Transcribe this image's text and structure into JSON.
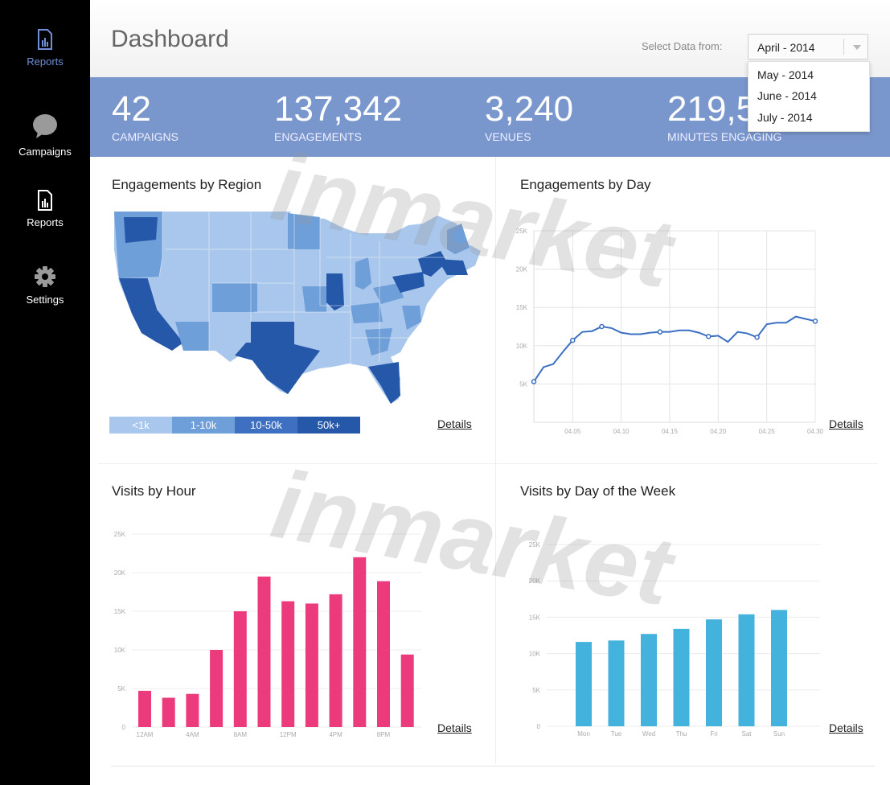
{
  "sidebar": {
    "items": [
      {
        "label": "Reports",
        "icon": "report-icon",
        "active": true
      },
      {
        "label": "Campaigns",
        "icon": "chat-bubble-icon",
        "active": false
      },
      {
        "label": "Reports",
        "icon": "report-icon",
        "active": false
      },
      {
        "label": "Settings",
        "icon": "gear-icon",
        "active": false
      }
    ]
  },
  "header": {
    "title": "Dashboard",
    "select_label": "Select Data from:",
    "selected": "April - 2014",
    "options": [
      "May - 2014",
      "June - 2014",
      "July - 2014"
    ]
  },
  "stats": [
    {
      "value": "42",
      "label": "CAMPAIGNS"
    },
    {
      "value": "137,342",
      "label": "ENGAGEMENTS"
    },
    {
      "value": "3,240",
      "label": "VENUES"
    },
    {
      "value": "219,5",
      "label": "MINUTES ENGAGING"
    }
  ],
  "panels": {
    "region": {
      "title": "Engagements by Region",
      "details": "Details",
      "legend": [
        "<1k",
        "1-10k",
        "10-50k",
        "50k+"
      ]
    },
    "day": {
      "title": "Engagements by Day",
      "details": "Details"
    },
    "hour": {
      "title": "Visits by Hour",
      "details": "Details"
    },
    "week": {
      "title": "Visits by Day of the Week",
      "details": "Details"
    }
  },
  "watermark": "inmarket",
  "colors": {
    "accent": "#7a97cd",
    "pink": "#ec3b7d",
    "cyan": "#43b2dc",
    "map_levels": [
      "#a9c6ec",
      "#6f9fd8",
      "#3e70c2",
      "#2558a8"
    ]
  },
  "chart_data": [
    {
      "type": "line",
      "title": "Engagements by Day",
      "x": [
        1,
        2,
        3,
        4,
        5,
        6,
        7,
        8,
        9,
        10,
        11,
        12,
        13,
        14,
        15,
        16,
        17,
        18,
        19,
        20,
        21,
        22,
        23,
        24,
        25,
        26,
        27,
        28,
        29,
        30
      ],
      "values": [
        5300,
        7200,
        7600,
        9200,
        10700,
        11800,
        11900,
        12500,
        12300,
        11700,
        11500,
        11500,
        11700,
        11800,
        11800,
        12000,
        12000,
        11700,
        11200,
        11300,
        10500,
        11800,
        11600,
        11100,
        12800,
        13000,
        13000,
        13800,
        13500,
        13200
      ],
      "xticks": [
        "04.05",
        "04.10",
        "04.15",
        "04.20",
        "04.25",
        "04.30"
      ],
      "yticks": [
        "5K",
        "10K",
        "15K",
        "20K",
        "25K"
      ],
      "ylim": [
        0,
        25000
      ]
    },
    {
      "type": "bar",
      "title": "Visits by Hour",
      "values": [
        4700,
        3800,
        4300,
        10000,
        15000,
        19500,
        16300,
        16000,
        17200,
        22000,
        18900,
        9400
      ],
      "xticks": [
        "12AM",
        "4AM",
        "8AM",
        "12PM",
        "4PM",
        "8PM"
      ],
      "yticks": [
        "0",
        "5K",
        "10K",
        "15K",
        "20K",
        "25K"
      ],
      "ylim": [
        0,
        25000
      ]
    },
    {
      "type": "bar",
      "title": "Visits by Day of the Week",
      "categories": [
        "Mon",
        "Tue",
        "Wed",
        "Thu",
        "Fri",
        "Sat",
        "Sun"
      ],
      "values": [
        11600,
        11800,
        12700,
        13400,
        14700,
        15400,
        16000
      ],
      "yticks": [
        "0",
        "5K",
        "10K",
        "15K",
        "20K",
        "25K"
      ],
      "ylim": [
        0,
        25000
      ]
    }
  ]
}
